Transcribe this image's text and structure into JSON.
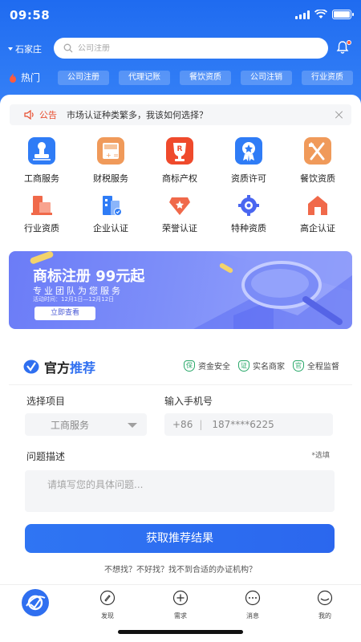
{
  "status": {
    "time": "09:58"
  },
  "header": {
    "city": "石家庄",
    "search_placeholder": "公司注册",
    "hot_label": "热门",
    "hot_tags": [
      "公司注册",
      "代理记账",
      "餐饮资质",
      "公司注销",
      "行业资质"
    ]
  },
  "notice": {
    "label": "公告",
    "message": "市场认证种类繁多，我该如何选择？"
  },
  "services": [
    {
      "label": "工商服务",
      "icon": "stamp-icon",
      "color": "#2f7cf6"
    },
    {
      "label": "财税服务",
      "icon": "calculator-icon",
      "color": "#f09a5a"
    },
    {
      "label": "商标产权",
      "icon": "trophy-icon",
      "color": "#ef4a2c"
    },
    {
      "label": "资质许可",
      "icon": "certificate-icon",
      "color": "#2f7cf6"
    },
    {
      "label": "餐饮资质",
      "icon": "fork-knife-icon",
      "color": "#f09a5a"
    },
    {
      "label": "行业资质",
      "icon": "industry-icon",
      "color": "#f0694a"
    },
    {
      "label": "企业认证",
      "icon": "building-icon",
      "color": "#2f7cf6"
    },
    {
      "label": "荣誉认证",
      "icon": "honor-icon",
      "color": "#f0694a"
    },
    {
      "label": "特种资质",
      "icon": "gear-icon",
      "color": "#4a66f0"
    },
    {
      "label": "高企认证",
      "icon": "house-icon",
      "color": "#f0694a"
    }
  ],
  "banner": {
    "title": "商标注册 99元起",
    "subtitle": "专业团队为您服务",
    "date": "活动时间：12月1日—12月12日",
    "button": "立即查看"
  },
  "recommend": {
    "title_a": "官方",
    "title_b": "推荐",
    "badges": [
      {
        "mark": "保",
        "text": "资金安全"
      },
      {
        "mark": "证",
        "text": "实名商家"
      },
      {
        "mark": "官",
        "text": "全程监督"
      }
    ],
    "project_label": "选择项目",
    "project_value": "工商服务",
    "phone_label": "输入手机号",
    "phone_prefix": "+86",
    "phone_placeholder": "187****6225",
    "desc_label": "问题描述",
    "optional": "*选填",
    "desc_placeholder": "请填写您的具体问题...",
    "submit": "获取推荐结果",
    "footer_link": "不想找？不好找？找不到合适的办证机构？"
  },
  "tabbar": [
    {
      "label": "",
      "icon": "home-logo-icon"
    },
    {
      "label": "发现",
      "icon": "discover-icon"
    },
    {
      "label": "需求",
      "icon": "plus-circle-icon"
    },
    {
      "label": "消息",
      "icon": "message-icon"
    },
    {
      "label": "我的",
      "icon": "profile-icon"
    }
  ]
}
